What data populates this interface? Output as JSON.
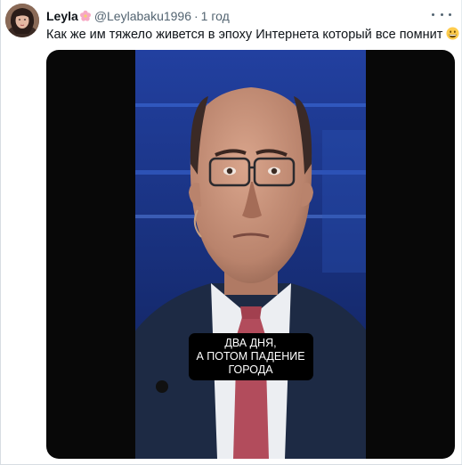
{
  "tweet": {
    "author": {
      "display_name": "Leyla",
      "name_icon": "cherry-blossom-icon",
      "handle": "@Leylabaku1996",
      "separator": "·",
      "time": "1 год"
    },
    "text": "Как же им тяжело живется в эпоху Интернета который все помнит",
    "text_emoji": "grinning-face-icon",
    "media": {
      "caption_line1": "ДВА ДНЯ,",
      "caption_line2": "А ПОТОМ ПАДЕНИЕ",
      "caption_line3": "ГОРОДА"
    }
  },
  "colors": {
    "text_primary": "#0f1419",
    "text_secondary": "#536471",
    "studio_blue": "#1b2f78"
  }
}
